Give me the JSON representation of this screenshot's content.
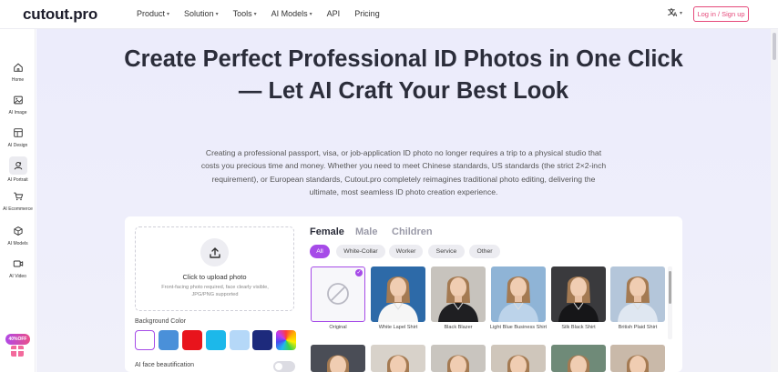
{
  "header": {
    "logo": "cutout.pro",
    "nav": [
      {
        "label": "Product",
        "caret": true
      },
      {
        "label": "Solution",
        "caret": true
      },
      {
        "label": "Tools",
        "caret": true
      },
      {
        "label": "AI Models",
        "caret": true
      },
      {
        "label": "API",
        "caret": false
      },
      {
        "label": "Pricing",
        "caret": false
      }
    ],
    "language_icon": "translate-icon",
    "login_label": "Log in / Sign up"
  },
  "sidebar": {
    "items": [
      {
        "label": "Home",
        "icon": "home-icon"
      },
      {
        "label": "AI Image",
        "icon": "image-icon"
      },
      {
        "label": "AI Design",
        "icon": "design-icon"
      },
      {
        "label": "AI Portrait",
        "icon": "portrait-icon",
        "active": true
      },
      {
        "label": "AI Ecommerce",
        "icon": "cart-icon"
      },
      {
        "label": "AI Models",
        "icon": "models-icon"
      },
      {
        "label": "AI Video",
        "icon": "video-icon"
      }
    ],
    "promo_label": "40%OFF"
  },
  "hero": {
    "title_line1": "Create Perfect Professional ID Photos in One Click",
    "title_line2": "— Let AI Craft Your Best Look",
    "description": "Creating a professional passport, visa, or job-application ID photo no longer requires a trip to a physical studio that costs you precious time and money. Whether you need to meet Chinese standards, US standards (the strict 2×2-inch requirement), or European standards, Cutout.pro completely reimagines traditional photo editing, delivering the ultimate, most seamless ID photo creation experience."
  },
  "upload": {
    "title": "Click to upload photo",
    "hint": "Front-facing photo required, face clearly visible, JPG/PNG supported"
  },
  "background": {
    "label": "Background Color",
    "swatches": [
      "#ffffff",
      "#4a90d9",
      "#e8141c",
      "#1cb8ea",
      "#b5d8f8",
      "#1d2a7c",
      "rainbow"
    ],
    "selected": 0
  },
  "beautify": {
    "label": "AI face beautification",
    "enabled": false
  },
  "gender_tabs": [
    {
      "label": "Female",
      "active": true
    },
    {
      "label": "Male",
      "active": false
    },
    {
      "label": "Children",
      "active": false
    }
  ],
  "category_tabs": [
    {
      "label": "All",
      "active": true
    },
    {
      "label": "White-Collar",
      "active": false
    },
    {
      "label": "Worker",
      "active": false
    },
    {
      "label": "Service",
      "active": false
    },
    {
      "label": "Other",
      "active": false
    }
  ],
  "styles": [
    {
      "label": "Original",
      "bg": "#ffffff",
      "outfit": "none",
      "selected": true
    },
    {
      "label": "White Lapel Shirt",
      "bg": "#2d6aa8",
      "outfit": "#f6f6f6"
    },
    {
      "label": "Black Blazer",
      "bg": "#c7c3bd",
      "outfit": "#1f1f22"
    },
    {
      "label": "Light Blue Business Shirt",
      "bg": "#8fb4d6",
      "outfit": "#bcd3ea"
    },
    {
      "label": "Silk Black Shirt",
      "bg": "#3a3a3d",
      "outfit": "#161618"
    },
    {
      "label": "British Plaid Shirt",
      "bg": "#b4c6da",
      "outfit": "#dfe7f1"
    }
  ],
  "styles_row2": [
    {
      "bg": "#4a4d56"
    },
    {
      "bg": "#d8d2ca"
    },
    {
      "bg": "#c9c5bf"
    },
    {
      "bg": "#cfc6bb"
    },
    {
      "bg": "#6f8a78"
    },
    {
      "bg": "#c9b9a9"
    }
  ],
  "colors": {
    "accent": "#a64be8",
    "login": "#e5497a"
  }
}
